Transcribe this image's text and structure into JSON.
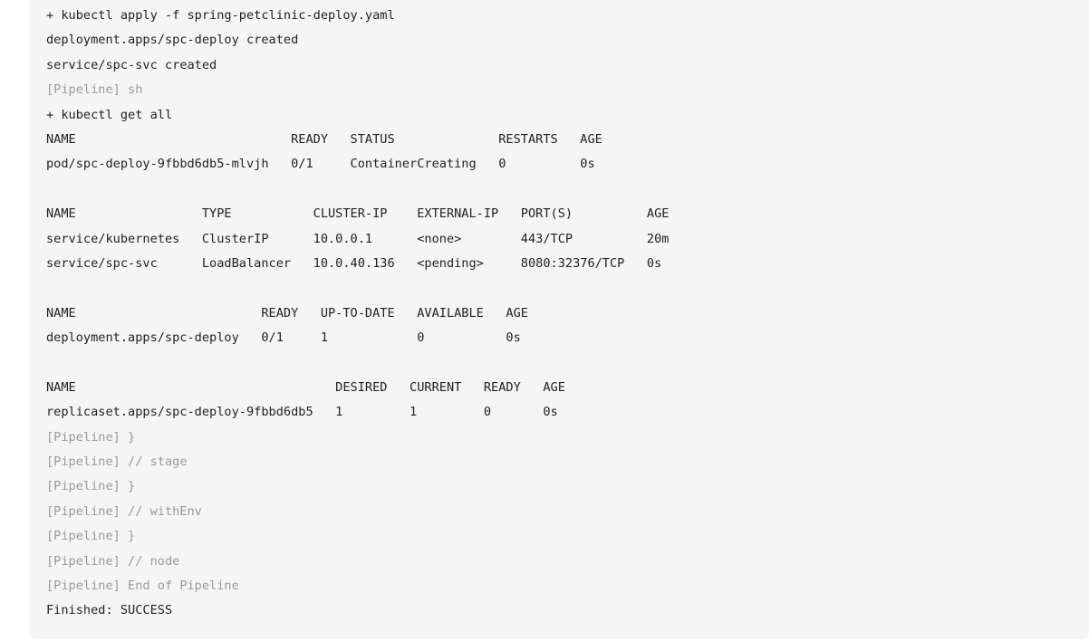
{
  "console": {
    "lines": [
      {
        "text": "+ kubectl apply -f spring-petclinic-deploy.yaml",
        "kind": "output"
      },
      {
        "text": "deployment.apps/spc-deploy created",
        "kind": "output"
      },
      {
        "text": "service/spc-svc created",
        "kind": "output"
      },
      {
        "text": "[Pipeline] sh",
        "kind": "pipeline"
      },
      {
        "text": "+ kubectl get all",
        "kind": "output"
      },
      {
        "text": "NAME                             READY   STATUS              RESTARTS   AGE",
        "kind": "output"
      },
      {
        "text": "pod/spc-deploy-9fbbd6db5-mlvjh   0/1     ContainerCreating   0          0s",
        "kind": "output"
      },
      {
        "text": "",
        "kind": "output"
      },
      {
        "text": "NAME                 TYPE           CLUSTER-IP    EXTERNAL-IP   PORT(S)          AGE",
        "kind": "output"
      },
      {
        "text": "service/kubernetes   ClusterIP      10.0.0.1      <none>        443/TCP          20m",
        "kind": "output"
      },
      {
        "text": "service/spc-svc      LoadBalancer   10.0.40.136   <pending>     8080:32376/TCP   0s",
        "kind": "output"
      },
      {
        "text": "",
        "kind": "output"
      },
      {
        "text": "NAME                         READY   UP-TO-DATE   AVAILABLE   AGE",
        "kind": "output"
      },
      {
        "text": "deployment.apps/spc-deploy   0/1     1            0           0s",
        "kind": "output"
      },
      {
        "text": "",
        "kind": "output"
      },
      {
        "text": "NAME                                   DESIRED   CURRENT   READY   AGE",
        "kind": "output"
      },
      {
        "text": "replicaset.apps/spc-deploy-9fbbd6db5   1         1         0       0s",
        "kind": "output"
      },
      {
        "text": "[Pipeline] }",
        "kind": "pipeline"
      },
      {
        "text": "[Pipeline] // stage",
        "kind": "pipeline"
      },
      {
        "text": "[Pipeline] }",
        "kind": "pipeline"
      },
      {
        "text": "[Pipeline] // withEnv",
        "kind": "pipeline"
      },
      {
        "text": "[Pipeline] }",
        "kind": "pipeline"
      },
      {
        "text": "[Pipeline] // node",
        "kind": "pipeline"
      },
      {
        "text": "[Pipeline] End of Pipeline",
        "kind": "pipeline"
      },
      {
        "text": "Finished: SUCCESS",
        "kind": "output"
      }
    ]
  },
  "colors": {
    "panel_background": "#f5f5f5",
    "output_text": "#222222",
    "pipeline_text": "#9a9a9a"
  }
}
